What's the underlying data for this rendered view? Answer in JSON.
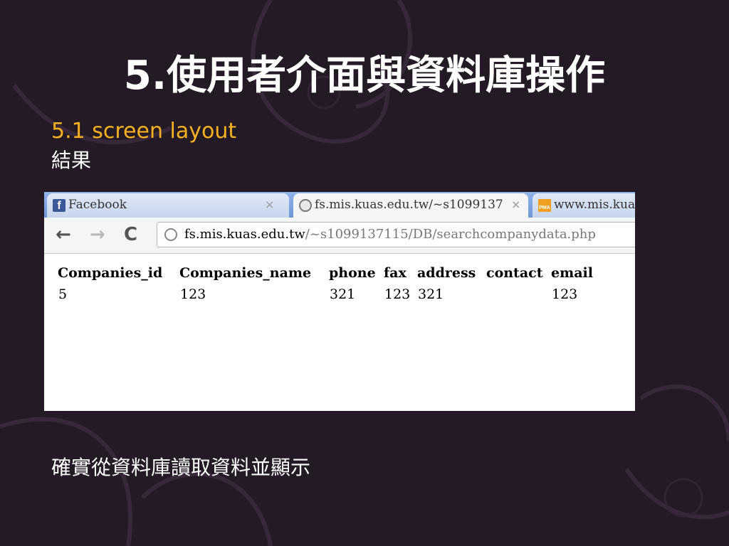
{
  "slide": {
    "title": "5.使用者介面與資料庫操作",
    "subtitle": "5.1 screen layout",
    "result_label": "結果",
    "footer": "確實從資料庫讀取資料並顯示",
    "colors": {
      "background": "#241a26",
      "subtitle": "#f5b120",
      "title": "#ffffff"
    }
  },
  "browser": {
    "tabs": [
      {
        "label": "Facebook",
        "icon": "facebook-icon",
        "close": "×"
      },
      {
        "label": "fs.mis.kuas.edu.tw/~s1099137",
        "icon": "globe-icon",
        "close": "×",
        "active": true
      },
      {
        "label": "www.mis.kua",
        "icon": "phpmyadmin-icon",
        "icon_text": "PMA"
      }
    ],
    "toolbar": {
      "back": "←",
      "forward": "→",
      "reload": "C"
    },
    "address": {
      "host": "fs.mis.kuas.edu.tw",
      "path": "/~s1099137115/DB/searchcompanydata.php"
    },
    "table": {
      "headers": [
        "Companies_id",
        "Companies_name",
        "phone",
        "fax",
        "address",
        "contact",
        "email"
      ],
      "rows": [
        [
          "5",
          "123",
          "321",
          "123",
          "321",
          "",
          "123"
        ]
      ]
    }
  }
}
